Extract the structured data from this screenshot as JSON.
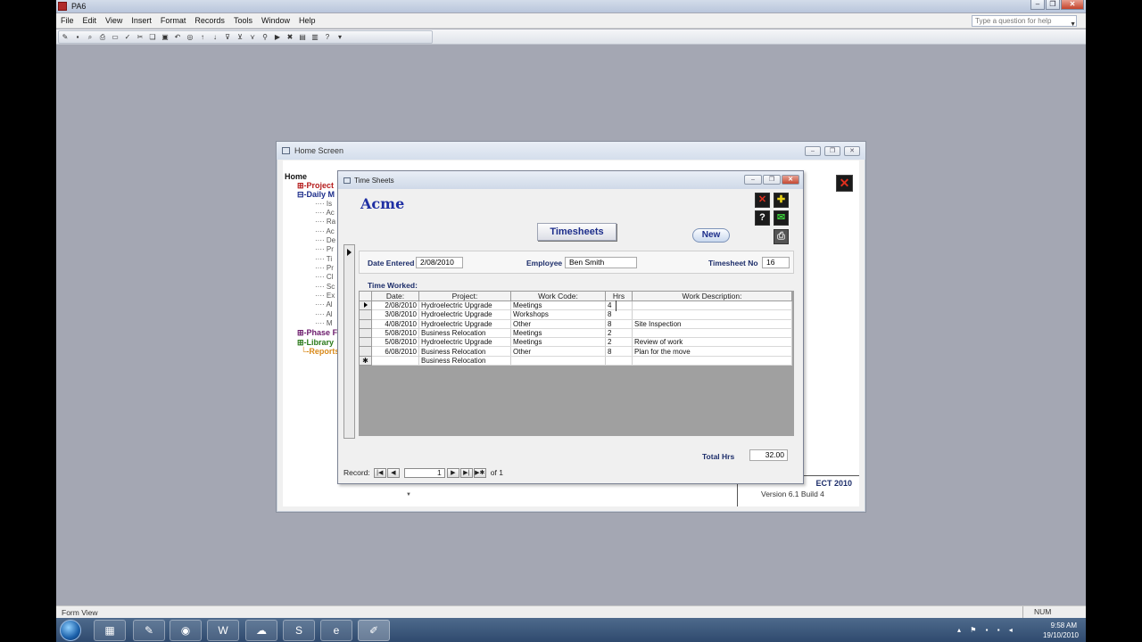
{
  "app": {
    "title": "PA6"
  },
  "menu": [
    "File",
    "Edit",
    "View",
    "Insert",
    "Format",
    "Records",
    "Tools",
    "Window",
    "Help"
  ],
  "help_placeholder": "Type a question for help",
  "home_screen": {
    "title": "Home Screen",
    "tree": {
      "home": "Home",
      "project": "Project",
      "daily": "Daily M",
      "sub_items": [
        "Is",
        "Ac",
        "Ra",
        "Ac",
        "De",
        "Pr",
        "Ti",
        "Pr",
        "Cl",
        "Sc",
        "Ex",
        "Al",
        "Al",
        "M"
      ],
      "phase": "Phase F",
      "library": "Library",
      "reports": "Reports"
    },
    "brand": {
      "name": "ECT 2010",
      "version": "Version 6.1 Build 4"
    }
  },
  "timesheets": {
    "window_title": "Time Sheets",
    "company": "Acme",
    "heading_button": "Timesheets",
    "new_button": "New",
    "date_entered_label": "Date Entered",
    "date_entered": "2/08/2010",
    "employee_label": "Employee",
    "employee": "Ben Smith",
    "timesheet_no_label": "Timesheet No",
    "timesheet_no": "16",
    "time_worked_label": "Time Worked:",
    "columns": [
      "Date:",
      "Project:",
      "Work Code:",
      "Hrs",
      "Work Description:"
    ],
    "rows": [
      {
        "date": "2/08/2010",
        "project": "Hydroelectric Upgrade",
        "code": "Meetings",
        "hrs": "4",
        "desc": ""
      },
      {
        "date": "3/08/2010",
        "project": "Hydroelectric Upgrade",
        "code": "Workshops",
        "hrs": "8",
        "desc": ""
      },
      {
        "date": "4/08/2010",
        "project": "Hydroelectric Upgrade",
        "code": "Other",
        "hrs": "8",
        "desc": "Site Inspection"
      },
      {
        "date": "5/08/2010",
        "project": "Business Relocation",
        "code": "Meetings",
        "hrs": "2",
        "desc": ""
      },
      {
        "date": "5/08/2010",
        "project": "Hydroelectric Upgrade",
        "code": "Meetings",
        "hrs": "2",
        "desc": "Review of work"
      },
      {
        "date": "6/08/2010",
        "project": "Business Relocation",
        "code": "Other",
        "hrs": "8",
        "desc": "Plan for the move"
      },
      {
        "date": "",
        "project": "Business Relocation",
        "code": "",
        "hrs": "",
        "desc": ""
      }
    ],
    "total_label": "Total Hrs",
    "total": "32.00",
    "record_nav": {
      "label": "Record:",
      "current": "1",
      "of": "of 1"
    }
  },
  "statusbar": {
    "left": "Form View",
    "right": "NUM"
  },
  "clock": {
    "time": "9:58 AM",
    "date": "19/10/2010"
  },
  "colors": {
    "accent": "#1f2fa3",
    "workspace": "#a4a7b3"
  }
}
